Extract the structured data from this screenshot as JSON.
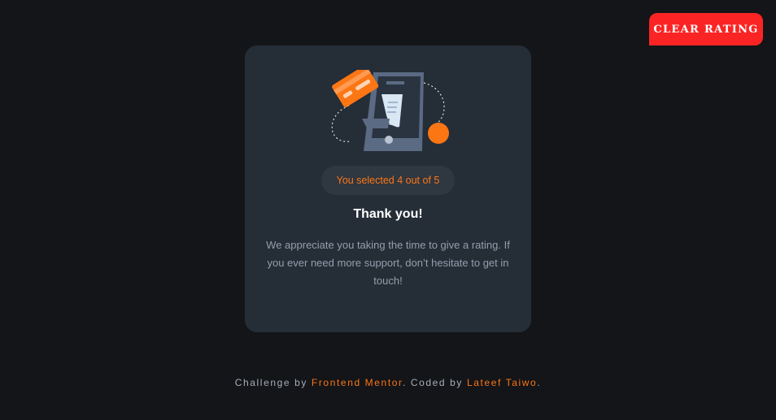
{
  "header": {
    "clear_rating_label": "CLEAR RATING"
  },
  "card": {
    "selection_text": "You selected 4 out of 5",
    "title": "Thank you!",
    "message": "We appreciate you taking the time to give a rating. If you ever need more support, don’t hesitate to get in touch!"
  },
  "footer": {
    "prefix": "Challenge by ",
    "challenge_link": "Frontend Mentor",
    "middle": ". Coded by ",
    "author_link": "Lateef Taiwo",
    "suffix": "."
  },
  "colors": {
    "background": "#131518",
    "card": "#252d37",
    "accent": "#fc7614",
    "clear_button": "#fb2424",
    "muted_text": "#959eac"
  },
  "icons": [
    "phone-receipt-illustration",
    "credit-card-icon"
  ]
}
